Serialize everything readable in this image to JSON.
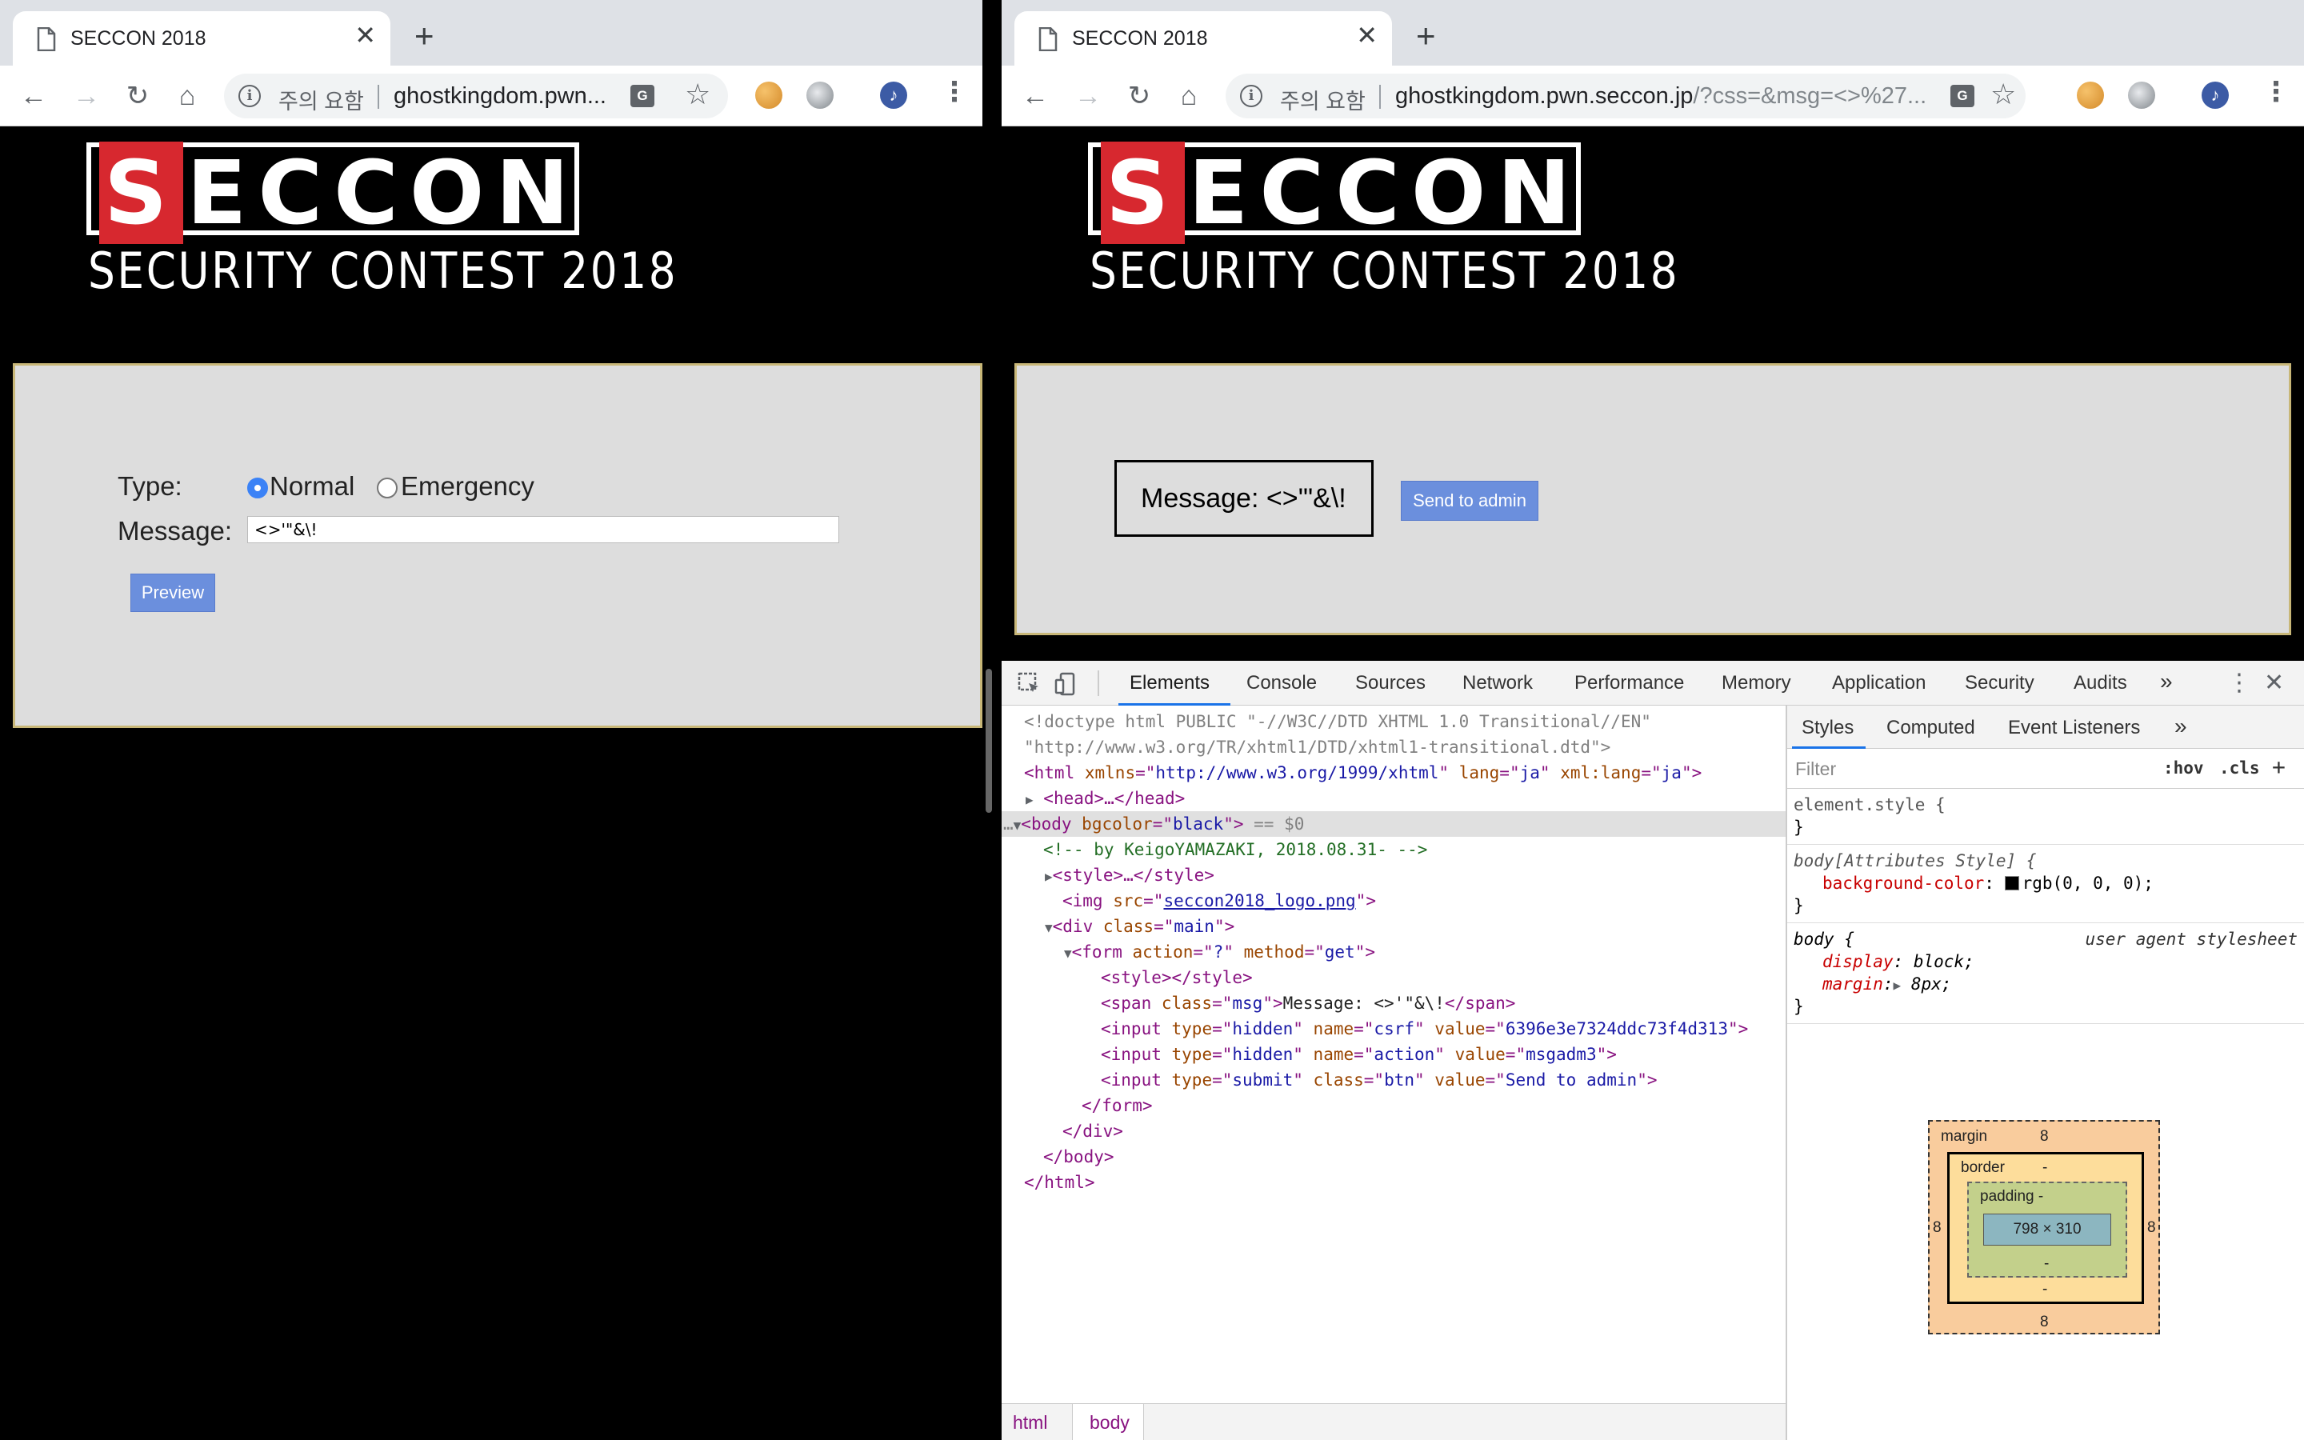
{
  "left_window": {
    "tab": {
      "title": "SECCON 2018"
    },
    "address": {
      "warning": "주의 요함",
      "url": "ghostkingdom.pwn...",
      "query": ""
    },
    "logo": {
      "brand": "SECCON",
      "subtitle": "SECURITY CONTEST 2018"
    },
    "form": {
      "type_label": "Type:",
      "radio_normal": "Normal",
      "radio_emergency": "Emergency",
      "selected_type": "Normal",
      "message_label": "Message:",
      "message_value": "<>'\"&\\!",
      "preview_button": "Preview"
    }
  },
  "right_window": {
    "tab": {
      "title": "SECCON 2018"
    },
    "address": {
      "warning": "주의 요함",
      "url": "ghostkingdom.pwn.seccon.jp",
      "query": "/?css=&msg=<>%27..."
    },
    "logo": {
      "brand": "SECCON",
      "subtitle": "SECURITY CONTEST 2018"
    },
    "preview": {
      "message": "Message: <>'\"&\\!",
      "send_button": "Send to admin"
    },
    "devtools": {
      "tabs": [
        "Elements",
        "Console",
        "Sources",
        "Network",
        "Performance",
        "Memory",
        "Application",
        "Security",
        "Audits"
      ],
      "active_tab": "Elements",
      "more_tabs": "»",
      "elements": {
        "doctype1": "<!doctype html PUBLIC \"-//W3C//DTD XHTML 1.0 Transitional//EN\"",
        "doctype2": "\"http://www.w3.org/TR/xhtml1/DTD/xhtml1-transitional.dtd\">",
        "html_open": "<html",
        "html_attr1_name": "xmlns",
        "html_attr1_val": "http://www.w3.org/1999/xhtml",
        "html_attr2_name": "lang",
        "html_attr2_val": "ja",
        "html_attr3_name": "xml:lang",
        "html_attr3_val": "ja",
        "head": "<head>…</head>",
        "body_tag": "<body",
        "body_attr_name": "bgcolor",
        "body_attr_val": "black",
        "body_suffix": "== $0",
        "comment": "<!-- by KeigoYAMAZAKI, 2018.08.31- -->",
        "style_collapsed": "<style>…</style>",
        "img_src": "seccon2018_logo.png",
        "div_class": "main",
        "form_action": "?",
        "form_method": "get",
        "style_empty": "<style></style>",
        "span_class": "msg",
        "span_text": "Message: <>'\"&\\!",
        "csrf_value": "6396e3e7324ddc73f4d313",
        "action_value": "msgadm3",
        "submit_value": "Send to admin",
        "form_close": "</form>",
        "div_close": "</div>",
        "body_close": "</body>",
        "html_close": "</html>"
      },
      "breadcrumb": [
        "html",
        "body"
      ],
      "styles": {
        "tabs": [
          "Styles",
          "Computed",
          "Event Listeners"
        ],
        "more": "»",
        "filter_placeholder": "Filter",
        "hov": ":hov",
        "cls": ".cls",
        "add": "+",
        "element_style": "element.style {",
        "close_brace": "}",
        "attr_style_selector": "body[Attributes Style] {",
        "bg_prop": "background-color",
        "bg_val": "rgb(0, 0, 0);",
        "body_selector": "body {",
        "ua_label": "user agent stylesheet",
        "display_prop": "display",
        "display_val": "block;",
        "margin_prop": "margin",
        "margin_val": "8px;",
        "box_model": {
          "margin_label": "margin",
          "margin_top": "8",
          "margin_bottom": "8",
          "margin_left": "8",
          "margin_right": "8",
          "border_label": "border",
          "border_val": "-",
          "padding_label": "padding -",
          "padding_bottom": "-",
          "content": "798 × 310"
        }
      }
    }
  }
}
